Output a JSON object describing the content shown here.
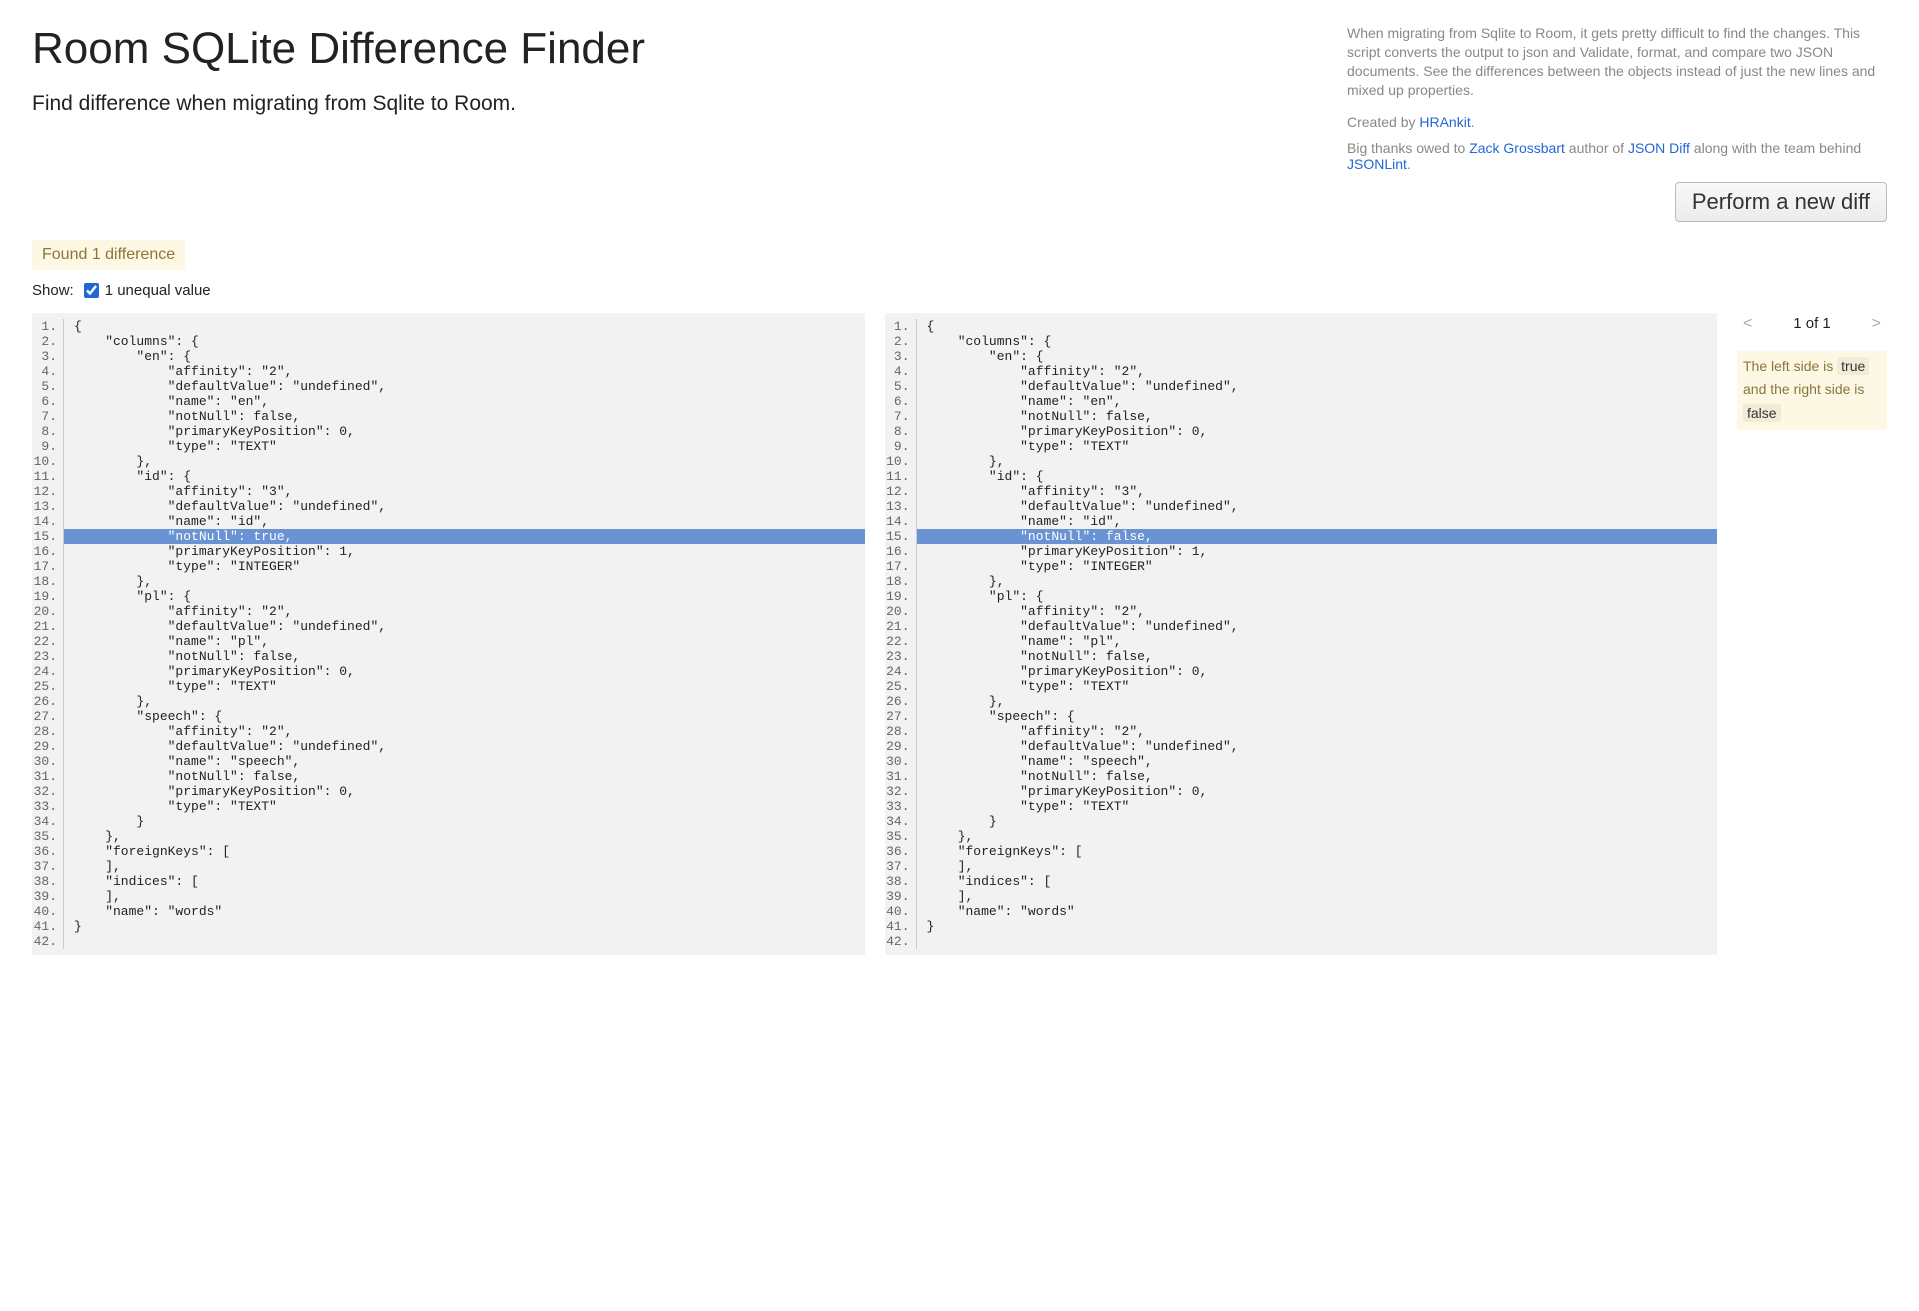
{
  "title": "Room SQLite Difference Finder",
  "subtitle": "Find difference when migrating from Sqlite to Room.",
  "description": "When migrating from Sqlite to Room, it gets pretty difficult to find the changes. This script converts the output to json and Validate, format, and compare two JSON documents. See the differences between the objects instead of just the new lines and mixed up properties.",
  "created_by_prefix": "Created by ",
  "created_by_link": "HRAnkit",
  "thanks_prefix": "Big thanks owed to ",
  "thanks_link1": "Zack Grossbart",
  "thanks_mid1": " author of ",
  "thanks_link2": "JSON Diff",
  "thanks_mid2": " along with the team behind ",
  "thanks_link3": "JSONLint",
  "report": "Found 1 difference",
  "show_label": "Show:",
  "checkbox_label": "1 unequal value",
  "button_label": "Perform a new diff",
  "nav_counter": "1 of 1",
  "diff_msg_pre": "The left side is",
  "diff_left_val": "true",
  "diff_msg_mid": "and the right side is",
  "diff_right_val": "false",
  "highlight_line": 15,
  "left_lines": [
    "{",
    "    \"columns\": {",
    "        \"en\": {",
    "            \"affinity\": \"2\",",
    "            \"defaultValue\": \"undefined\",",
    "            \"name\": \"en\",",
    "            \"notNull\": false,",
    "            \"primaryKeyPosition\": 0,",
    "            \"type\": \"TEXT\"",
    "        },",
    "        \"id\": {",
    "            \"affinity\": \"3\",",
    "            \"defaultValue\": \"undefined\",",
    "            \"name\": \"id\",",
    "            \"notNull\": true,",
    "            \"primaryKeyPosition\": 1,",
    "            \"type\": \"INTEGER\"",
    "        },",
    "        \"pl\": {",
    "            \"affinity\": \"2\",",
    "            \"defaultValue\": \"undefined\",",
    "            \"name\": \"pl\",",
    "            \"notNull\": false,",
    "            \"primaryKeyPosition\": 0,",
    "            \"type\": \"TEXT\"",
    "        },",
    "        \"speech\": {",
    "            \"affinity\": \"2\",",
    "            \"defaultValue\": \"undefined\",",
    "            \"name\": \"speech\",",
    "            \"notNull\": false,",
    "            \"primaryKeyPosition\": 0,",
    "            \"type\": \"TEXT\"",
    "        }",
    "    },",
    "    \"foreignKeys\": [",
    "    ],",
    "    \"indices\": [",
    "    ],",
    "    \"name\": \"words\"",
    "}",
    ""
  ],
  "right_lines": [
    "{",
    "    \"columns\": {",
    "        \"en\": {",
    "            \"affinity\": \"2\",",
    "            \"defaultValue\": \"undefined\",",
    "            \"name\": \"en\",",
    "            \"notNull\": false,",
    "            \"primaryKeyPosition\": 0,",
    "            \"type\": \"TEXT\"",
    "        },",
    "        \"id\": {",
    "            \"affinity\": \"3\",",
    "            \"defaultValue\": \"undefined\",",
    "            \"name\": \"id\",",
    "            \"notNull\": false,",
    "            \"primaryKeyPosition\": 1,",
    "            \"type\": \"INTEGER\"",
    "        },",
    "        \"pl\": {",
    "            \"affinity\": \"2\",",
    "            \"defaultValue\": \"undefined\",",
    "            \"name\": \"pl\",",
    "            \"notNull\": false,",
    "            \"primaryKeyPosition\": 0,",
    "            \"type\": \"TEXT\"",
    "        },",
    "        \"speech\": {",
    "            \"affinity\": \"2\",",
    "            \"defaultValue\": \"undefined\",",
    "            \"name\": \"speech\",",
    "            \"notNull\": false,",
    "            \"primaryKeyPosition\": 0,",
    "            \"type\": \"TEXT\"",
    "        }",
    "    },",
    "    \"foreignKeys\": [",
    "    ],",
    "    \"indices\": [",
    "    ],",
    "    \"name\": \"words\"",
    "}",
    ""
  ]
}
